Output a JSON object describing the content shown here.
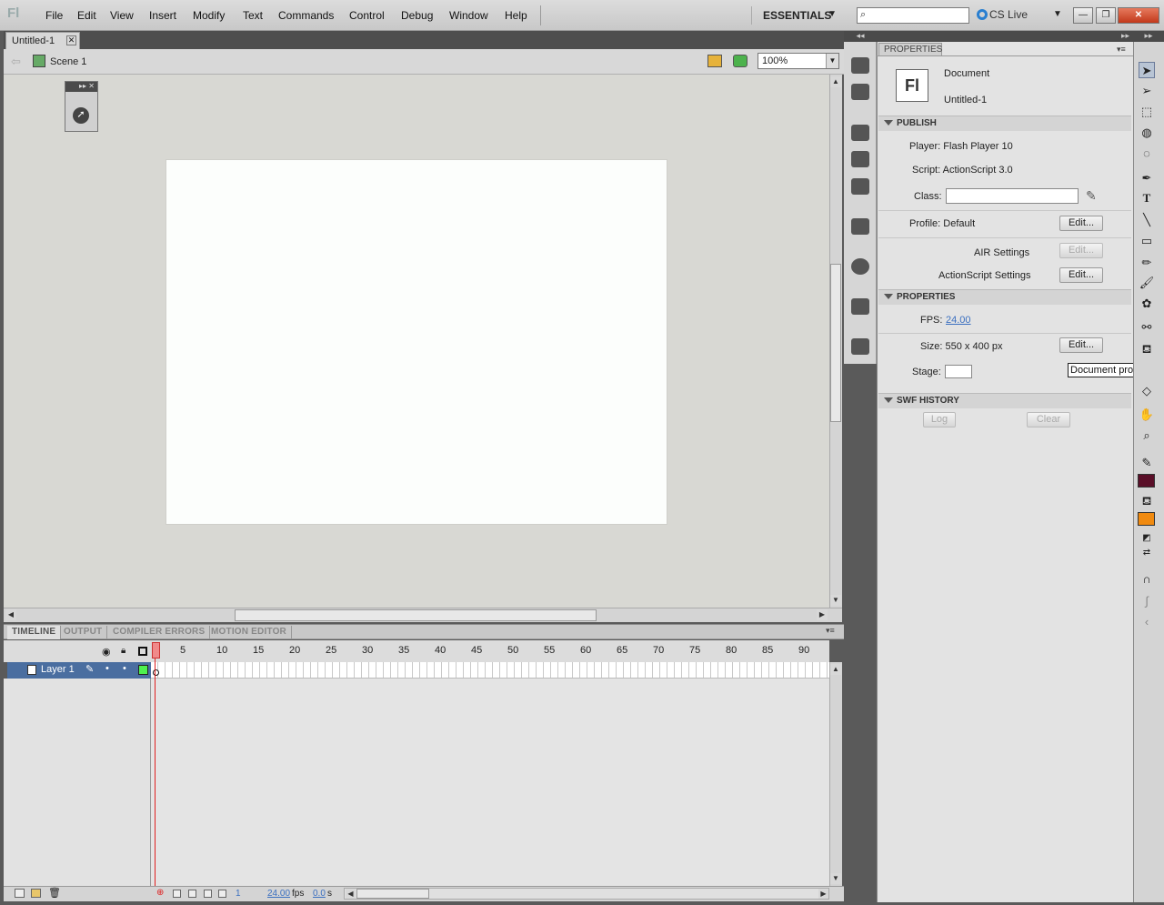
{
  "app": {
    "logo": "Fl"
  },
  "menu": [
    "File",
    "Edit",
    "View",
    "Insert",
    "Modify",
    "Text",
    "Commands",
    "Control",
    "Debug",
    "Window",
    "Help"
  ],
  "workspace": {
    "label": "ESSENTIALS",
    "arrow": "▼"
  },
  "search": {
    "placeholder": "",
    "icon": "search-icon"
  },
  "cslive": {
    "label": "CS Live",
    "arrow": "▼"
  },
  "window_buttons": {
    "minimize": "—",
    "restore": "❐",
    "close": "✕"
  },
  "document_tab": {
    "title": "Untitled-1",
    "close": "✕"
  },
  "editbar": {
    "scene": "Scene 1",
    "zoom": "100%"
  },
  "timeline": {
    "tabs": [
      "TIMELINE",
      "OUTPUT",
      "COMPILER ERRORS",
      "MOTION EDITOR"
    ],
    "frame_ticks": [
      "5",
      "10",
      "15",
      "20",
      "25",
      "30",
      "35",
      "40",
      "45",
      "50",
      "55",
      "60",
      "65",
      "70",
      "75",
      "80",
      "85",
      "90"
    ],
    "current_frame_tick": "1",
    "layer_name": "Layer 1",
    "status": {
      "frame": "1",
      "fps": "24.00",
      "fps_unit": "fps",
      "time": "0.0",
      "time_unit": "s"
    }
  },
  "properties": {
    "tab": "PROPERTIES",
    "doc_icon": "Fl",
    "doc_type": "Document",
    "doc_name": "Untitled-1",
    "publish": {
      "header": "PUBLISH",
      "player": "Player: Flash Player 10",
      "script": "Script: ActionScript 3.0",
      "class_label": "Class:",
      "class_value": "",
      "profile": "Profile: Default",
      "edit": "Edit...",
      "air_settings": "AIR Settings",
      "as_settings": "ActionScript Settings"
    },
    "props": {
      "header": "PROPERTIES",
      "fps_label": "FPS:",
      "fps_value": "24.00",
      "size": "Size: 550 x 400 px",
      "stage_label": "Stage:",
      "stage_color": "#ffffff"
    },
    "swf_history": {
      "header": "SWF HISTORY",
      "log": "Log",
      "clear": "Clear"
    }
  },
  "tooltip": "Document properties",
  "colors": {
    "stroke": "#5a0f28",
    "fill": "#f08a10",
    "layer_highlight": "#4a6ea0"
  }
}
